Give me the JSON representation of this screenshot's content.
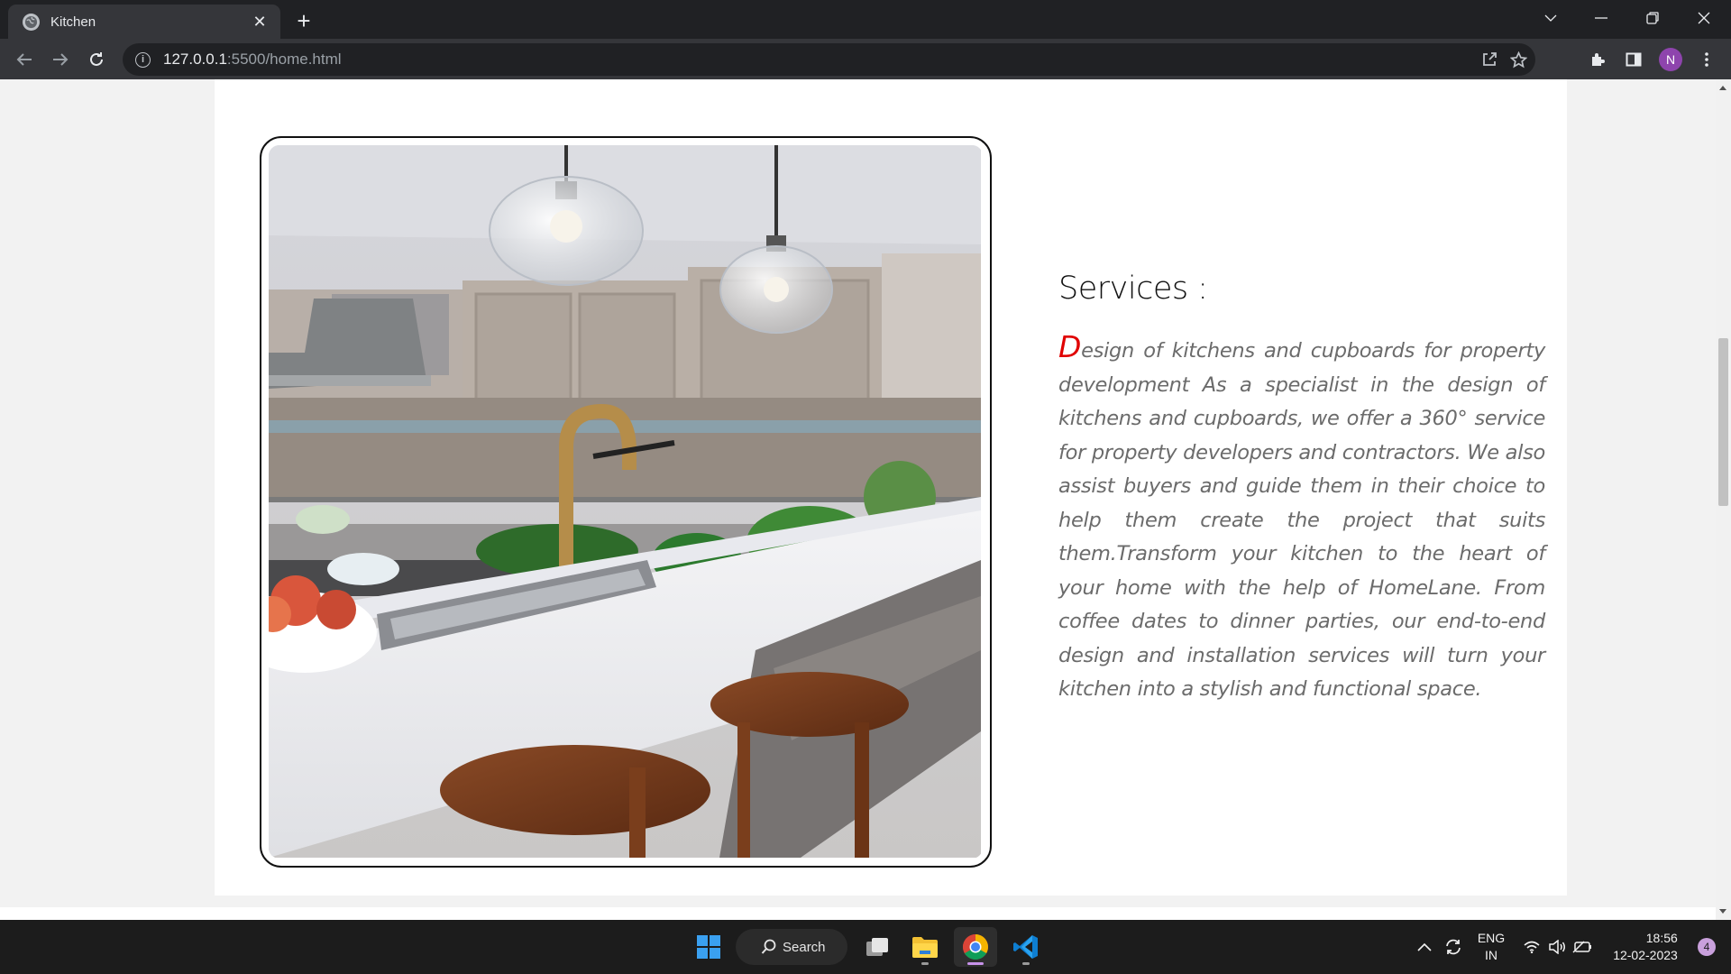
{
  "browser": {
    "tab_title": "Kitchen",
    "tab_close": "✕",
    "new_tab": "+",
    "url_host": "127.0.0.1",
    "url_path": ":5500/home.html",
    "profile_initial": "N"
  },
  "page": {
    "services_title": "Services :",
    "services_dropcap": "D",
    "services_text": "esign of kitchens and cupboards for property development As a specialist in the design of kitchens and cupboards, we offer a 360° service for property developers and contractors. We also assist buyers and guide them in their choice to help them create the project that suits them.Transform your kitchen to the heart of your home with the help of HomeLane. From coffee dates to dinner parties, our end-to-end design and installation services will turn your kitchen into a stylish and functional space.",
    "image_subject": "kitchen-island-photo",
    "dropcap_color": "#e00000"
  },
  "taskbar": {
    "search_label": "Search",
    "lang_primary": "ENG",
    "lang_secondary": "IN",
    "time": "18:56",
    "date": "12-02-2023",
    "notification_count": "4",
    "apps": [
      "windows-start",
      "search",
      "task-view",
      "file-explorer",
      "chrome",
      "vscode"
    ]
  },
  "scrollbar": {
    "position_fraction": 0.38
  }
}
